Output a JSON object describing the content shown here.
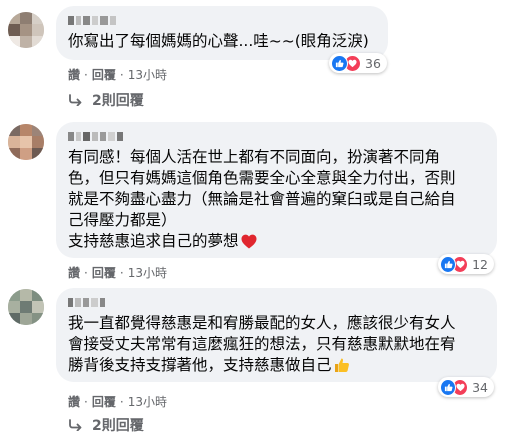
{
  "comments": [
    {
      "text_lines": [
        "你寫出了每個媽媽的心聲...哇~~(眼角泛淚)"
      ],
      "reaction_count": "36",
      "reactions": [
        "like-icon",
        "heart-icon"
      ],
      "actions": {
        "like": "讚",
        "reply": "回覆",
        "time": "13小時"
      },
      "replies_label": "2則回覆"
    },
    {
      "text_lines": [
        "有同感！每個人活在世上都有不同面向，扮演著不同角",
        "色，但只有媽媽這個角色需要全心全意與全力付出，否則",
        "就是不夠盡心盡力（無論是社會普遍的窠臼或是自己給自",
        "己得壓力都是）",
        "支持慈惠追求自己的夢想"
      ],
      "end_emoji": "red-heart-icon",
      "reaction_count": "12",
      "reactions": [
        "like-icon",
        "heart-icon"
      ],
      "actions": {
        "like": "讚",
        "reply": "回覆",
        "time": "13小時"
      }
    },
    {
      "text_lines": [
        "我一直都覺得慈惠是和宥勝最配的女人，應該很少有女人",
        "會接受丈夫常常有這麼瘋狂的想法，只有慈惠默默地在宥",
        "勝背後支持支撐著他，支持慈惠做自己"
      ],
      "end_emoji": "thumbs-up-icon",
      "reaction_count": "34",
      "reactions": [
        "like-icon",
        "heart-icon"
      ],
      "actions": {
        "like": "讚",
        "reply": "回覆",
        "time": "13小時"
      },
      "replies_label": "2則回覆"
    }
  ],
  "colors": {
    "bubble": "#f0f2f5",
    "secondary_text": "#65676b",
    "like_blue": "#1877f2",
    "love_red": "#f33e58"
  }
}
